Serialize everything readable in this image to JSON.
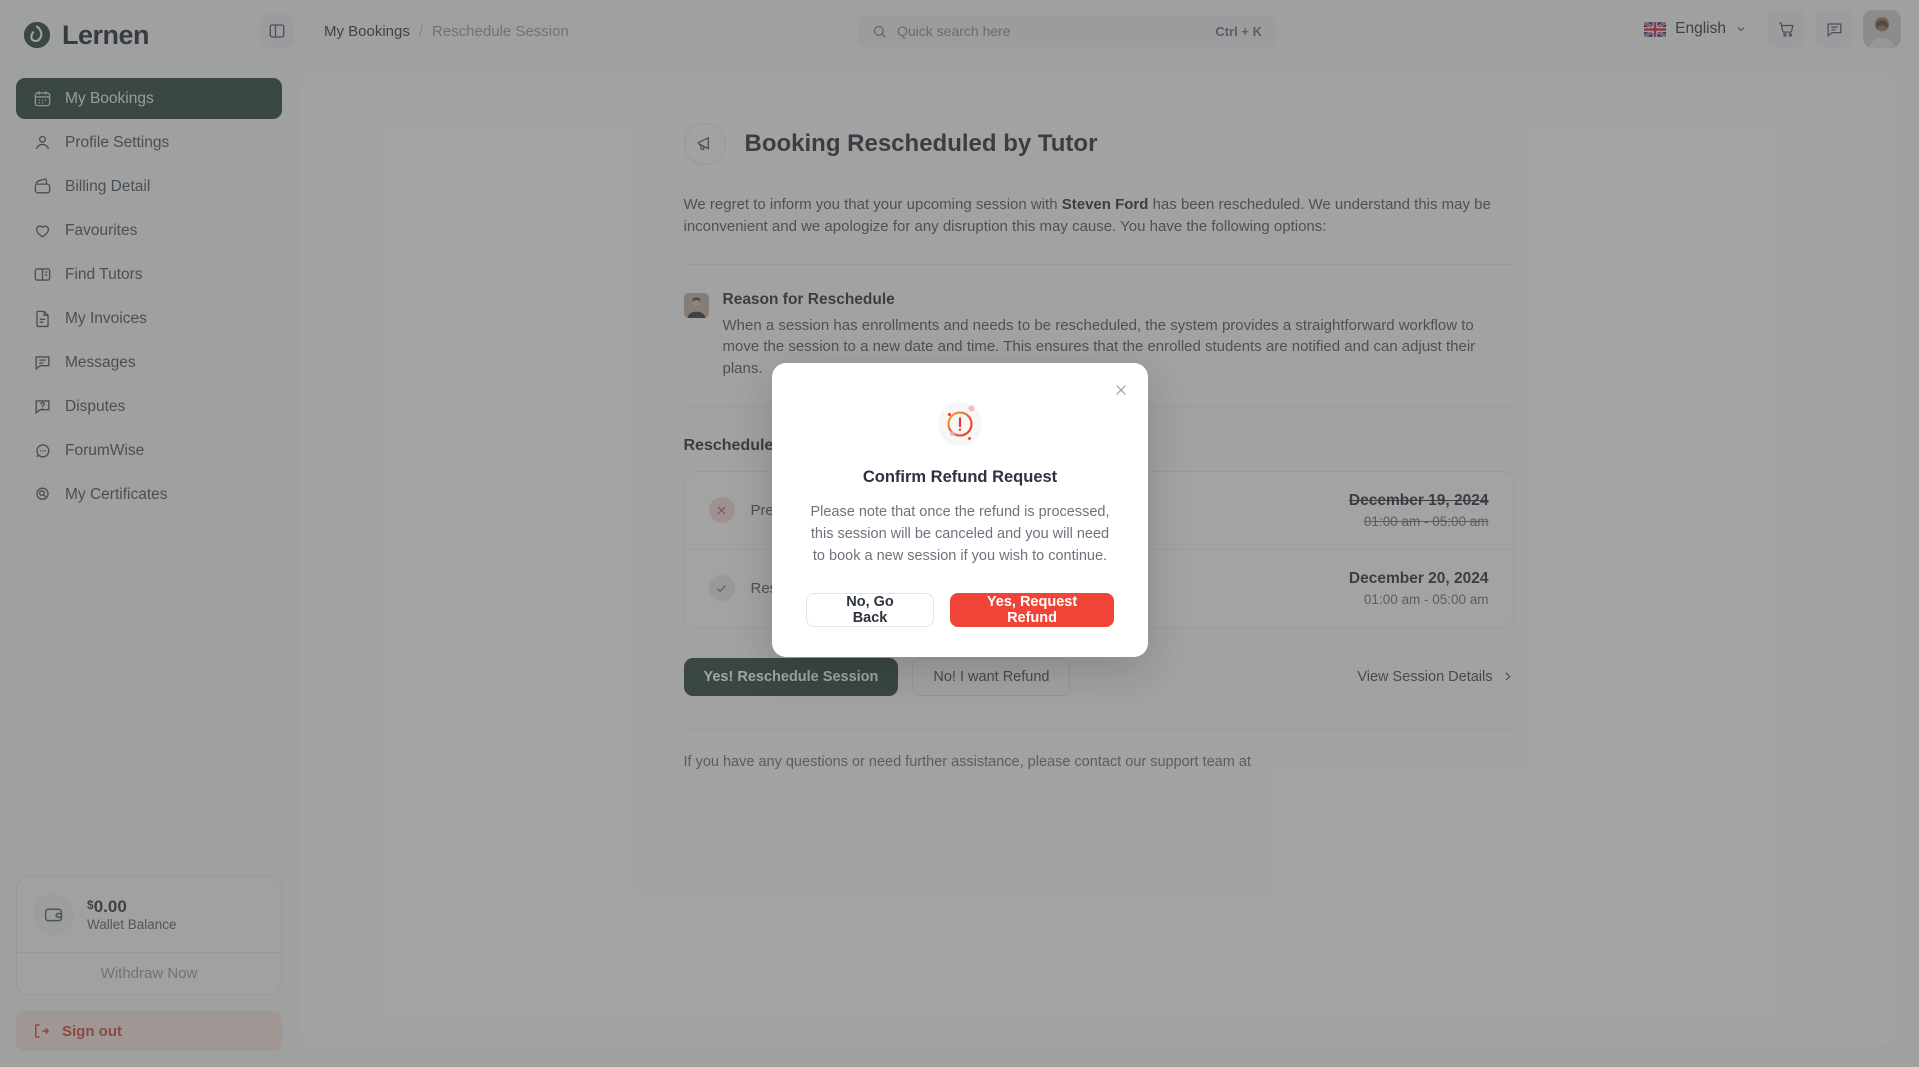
{
  "brand": {
    "name": "Lernen"
  },
  "sidebar": {
    "items": [
      {
        "label": "My Bookings",
        "icon": "calendar-icon",
        "active": true
      },
      {
        "label": "Profile Settings",
        "icon": "user-icon",
        "active": false
      },
      {
        "label": "Billing Detail",
        "icon": "wallet-icon",
        "active": false
      },
      {
        "label": "Favourites",
        "icon": "heart-icon",
        "active": false
      },
      {
        "label": "Find Tutors",
        "icon": "book-icon",
        "active": false
      },
      {
        "label": "My Invoices",
        "icon": "document-icon",
        "active": false
      },
      {
        "label": "Messages",
        "icon": "chat-icon",
        "active": false
      },
      {
        "label": "Disputes",
        "icon": "question-chat-icon",
        "active": false
      },
      {
        "label": "ForumWise",
        "icon": "forum-icon",
        "active": false
      },
      {
        "label": "My Certificates",
        "icon": "badge-search-icon",
        "active": false
      }
    ],
    "wallet": {
      "currency": "$",
      "amount": "0.00",
      "label": "Wallet Balance",
      "withdraw_label": "Withdraw Now"
    },
    "signout_label": "Sign out"
  },
  "topbar": {
    "breadcrumb": {
      "parent": "My Bookings",
      "separator": "/",
      "current": "Reschedule Session"
    },
    "search": {
      "placeholder": "Quick search here",
      "shortcut": "Ctrl + K"
    },
    "language": "English"
  },
  "main": {
    "title": "Booking Rescheduled by Tutor",
    "intro_before": "We regret to inform you that your upcoming session with ",
    "intro_tutor": "Steven Ford",
    "intro_after": " has been rescheduled. We understand this may be inconvenient and we apologize for any disruption this may cause. You have the following options:",
    "reason": {
      "title": "Reason for Reschedule",
      "body": "When a session has enrollments and needs to be rescheduled, the system provides a straightforward workflow to move the session to a new date and time. This ensures that the enrolled students are notified and can adjust their plans."
    },
    "sessions_title": "Rescheduled Session Details",
    "sessions": [
      {
        "status_icon": "cross-icon",
        "label": "Previous Schedule",
        "date": "December 19, 2024",
        "time": "01:00 am - 05:00 am",
        "struck": true
      },
      {
        "status_icon": "check-icon",
        "label": "Rescheduled To",
        "date": "December 20, 2024",
        "time": "01:00 am - 05:00 am",
        "struck": false
      }
    ],
    "actions": {
      "accept_label": "Yes! Reschedule Session",
      "refund_label": "No! I want Refund",
      "details_label": "View Session Details"
    },
    "footnote": "If you have any questions or need further assistance, please contact our support team at"
  },
  "modal": {
    "title": "Confirm Refund Request",
    "text": "Please note that once the refund is processed, this session will be canceled and you will need to book a new session if you wish to continue.",
    "cancel_label": "No, Go Back",
    "confirm_label": "Yes, Request Refund"
  },
  "colors": {
    "brand_green": "#143226",
    "danger_red": "#f04436",
    "signout_red": "#c0392b"
  }
}
